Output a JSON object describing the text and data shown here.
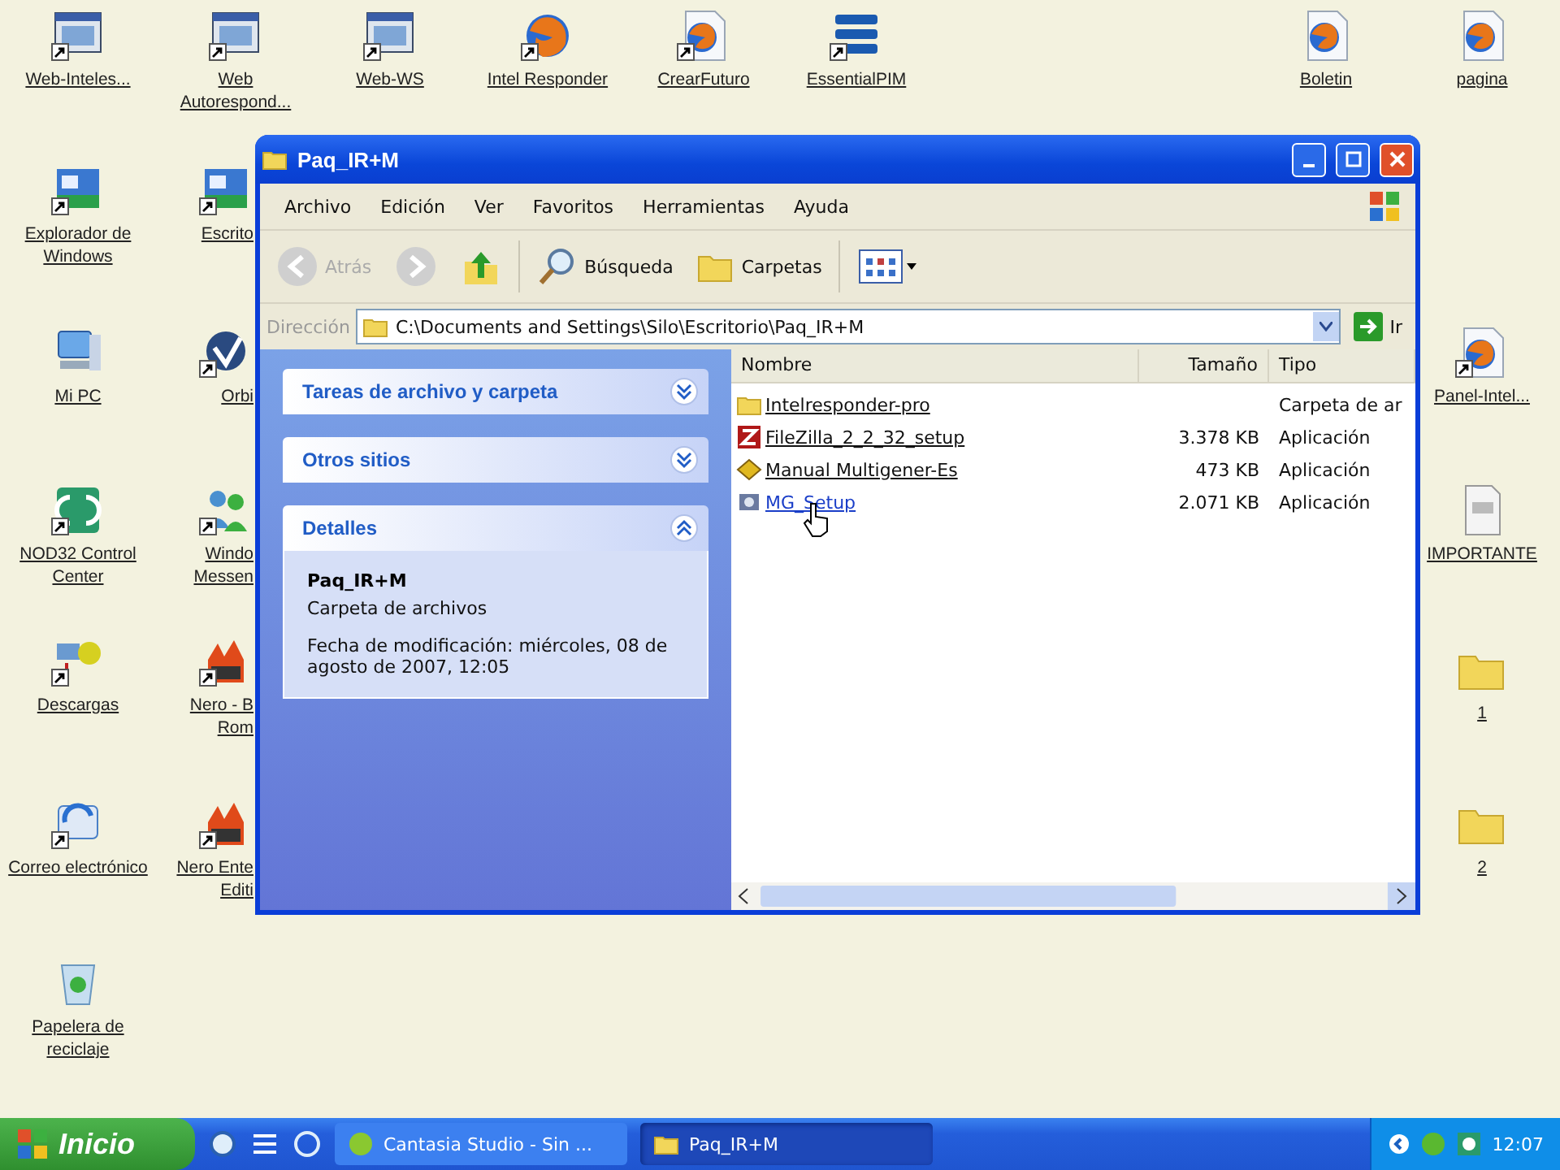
{
  "desktop_icons": [
    {
      "label": "Web-Inteles...",
      "kind": "window",
      "shortcut": true
    },
    {
      "label": "Explorador de Windows",
      "kind": "explorer",
      "shortcut": true
    },
    {
      "label": "Mi PC",
      "kind": "computer",
      "shortcut": false
    },
    {
      "label": "NOD32 Control Center",
      "kind": "nod",
      "shortcut": true
    },
    {
      "label": "Descargas",
      "kind": "download",
      "shortcut": true
    },
    {
      "label": "Correo electrónico",
      "kind": "mail",
      "shortcut": true
    },
    {
      "label": "Papelera de reciclaje",
      "kind": "recycle",
      "shortcut": false
    },
    {
      "label": "Web Autorespond...",
      "kind": "window",
      "shortcut": true
    },
    {
      "label": "Escrito",
      "kind": "explorer",
      "shortcut": true
    },
    {
      "label": "Orbi",
      "kind": "orb",
      "shortcut": true
    },
    {
      "label": "Windo Messen",
      "kind": "messenger",
      "shortcut": true
    },
    {
      "label": "Nero - B Rom",
      "kind": "nero",
      "shortcut": true
    },
    {
      "label": "Nero Ente Editi",
      "kind": "nero",
      "shortcut": true
    },
    {
      "label": "Web-WS",
      "kind": "window",
      "shortcut": true
    },
    {
      "label": "Intel Responder",
      "kind": "firefox",
      "shortcut": true
    },
    {
      "label": "CrearFuturo",
      "kind": "firefox-doc",
      "shortcut": true
    },
    {
      "label": "EssentialPIM",
      "kind": "stack",
      "shortcut": true
    },
    {
      "label": "Boletin",
      "kind": "firefox-doc",
      "shortcut": false
    },
    {
      "label": "pagina",
      "kind": "firefox-doc",
      "shortcut": false
    },
    {
      "label": "Panel-Intel...",
      "kind": "firefox-doc",
      "shortcut": true
    },
    {
      "label": "IMPORTANTE",
      "kind": "doc",
      "shortcut": false
    },
    {
      "label": "1",
      "kind": "folder",
      "shortcut": false
    },
    {
      "label": "2",
      "kind": "folder",
      "shortcut": false
    }
  ],
  "window": {
    "title": "Paq_IR+M",
    "menu": [
      "Archivo",
      "Edición",
      "Ver",
      "Favoritos",
      "Herramientas",
      "Ayuda"
    ],
    "toolbar": [
      {
        "kind": "back",
        "label": "Atrás",
        "disabled": true
      },
      {
        "kind": "forward",
        "disabled": true
      },
      {
        "kind": "up",
        "disabled": false
      },
      {
        "kind": "search",
        "label": "Búsqueda",
        "disabled": false
      },
      {
        "kind": "folders",
        "label": "Carpetas",
        "disabled": false
      },
      {
        "kind": "views",
        "disabled": false
      }
    ],
    "address": {
      "label": "Dirección",
      "value": "C:\\Documents and Settings\\Silo\\Escritorio\\Paq_IR+M",
      "go": "Ir"
    },
    "task_pane": [
      {
        "title": "Tareas de archivo y carpeta",
        "expanded": false
      },
      {
        "title": "Otros sitios",
        "expanded": false
      },
      {
        "title": "Detalles",
        "expanded": true,
        "name": "Paq_IR+M",
        "type": "Carpeta de archivos",
        "modified": "Fecha de modificación: miércoles, 08 de agosto de 2007, 12:05"
      }
    ],
    "columns": [
      "Nombre",
      "Tamaño",
      "Tipo"
    ],
    "files": [
      {
        "name": "Intelresponder-pro",
        "type": "Carpeta de ar",
        "kind": "folder",
        "hovered": false
      },
      {
        "name": "FileZilla_2_2_32_setup",
        "size": "3.378 KB",
        "type": "Aplicación",
        "kind": "app",
        "hovered": false
      },
      {
        "name": "Manual Multigener-Es",
        "size": "473 KB",
        "type": "Aplicación",
        "kind": "package",
        "hovered": false
      },
      {
        "name": "MG_Setup",
        "size": "2.071 KB",
        "type": "Aplicación",
        "kind": "installer",
        "hovered": true
      }
    ]
  },
  "taskbar": {
    "start": "Inicio",
    "tasks": [
      {
        "label": "Cantasia Studio - Sin ...",
        "selected": false
      },
      {
        "label": "Paq_IR+M",
        "selected": true
      }
    ],
    "clock": "12:07"
  }
}
